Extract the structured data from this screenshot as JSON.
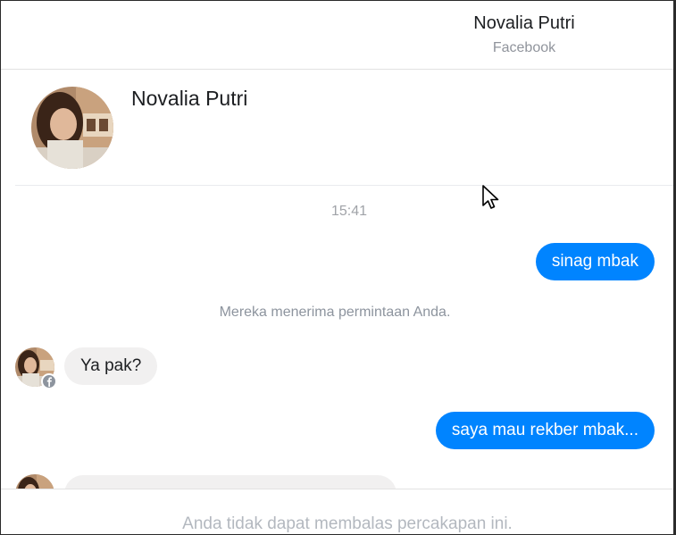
{
  "header": {
    "title": "Novalia Putri",
    "subtitle": "Facebook"
  },
  "profile": {
    "name": "Novalia Putri"
  },
  "conversation": {
    "timestamp": "15:41",
    "messages": [
      {
        "direction": "outgoing",
        "text": "sinag mbak"
      },
      {
        "direction": "system",
        "text": "Mereka menerima permintaan Anda."
      },
      {
        "direction": "incoming",
        "text": "Ya pak?"
      },
      {
        "direction": "outgoing",
        "text": "saya mau rekber mbak..."
      }
    ]
  },
  "composer": {
    "disabled_text": "Anda tidak dapat membalas percakapan ini."
  },
  "colors": {
    "outgoing_bubble": "#0084ff",
    "incoming_bubble": "#f1f0f0"
  }
}
